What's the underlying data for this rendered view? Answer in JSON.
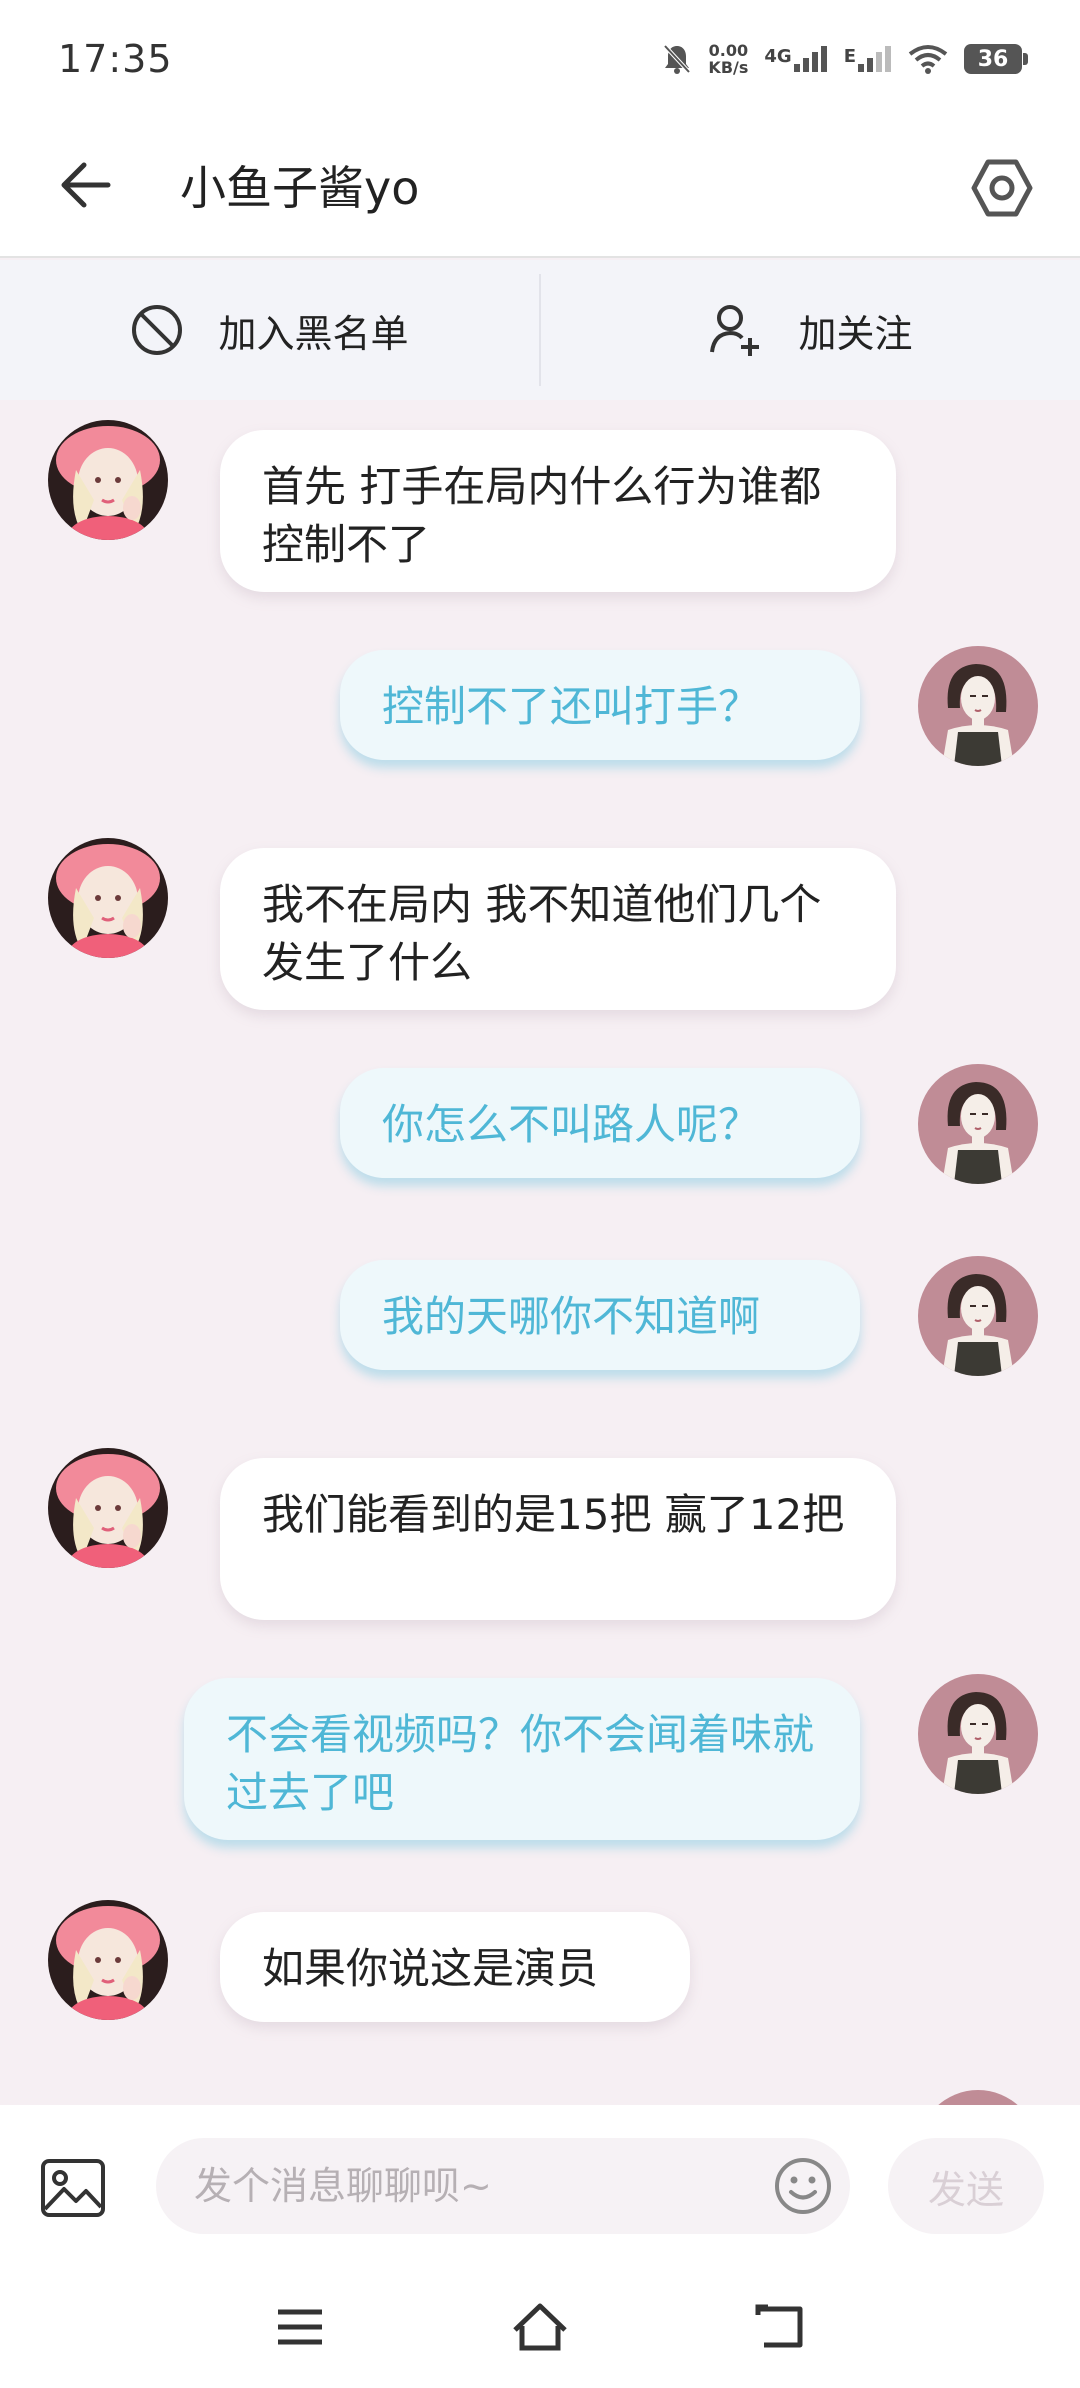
{
  "status_bar": {
    "time": "17:35",
    "net_speed_value": "0.00",
    "net_speed_unit": "KB/s",
    "signal1_label": "4G",
    "signal2_label": "E",
    "battery": "36",
    "icons": [
      "mute-bell-icon",
      "signal-icon",
      "signal-icon",
      "wifi-icon",
      "battery-icon"
    ]
  },
  "header": {
    "title": "小鱼子酱yo",
    "back_icon": "arrow-left-icon",
    "settings_icon": "hexagon-settings-icon"
  },
  "actions": {
    "blacklist_label": "加入黑名单",
    "follow_label": "加关注"
  },
  "messages": [
    {
      "side": "in",
      "text": "首先 打手在局内什么行为谁都控制不了"
    },
    {
      "side": "out",
      "text": "控制不了还叫打手？"
    },
    {
      "side": "in",
      "text": "我不在局内 我不知道他们几个发生了什么"
    },
    {
      "side": "out",
      "text": "你怎么不叫路人呢？"
    },
    {
      "side": "out",
      "text": "我的天哪你不知道啊"
    },
    {
      "side": "in",
      "text": "我们能看到的是15把 赢了12把"
    },
    {
      "side": "out",
      "text": "不会看视频吗？你不会闻着味就过去了吧"
    },
    {
      "side": "in",
      "text": "如果你说这是演员"
    }
  ],
  "input": {
    "placeholder": "发个消息聊聊呗~",
    "value": "",
    "send_label": "发送"
  },
  "colors": {
    "chat_background": "#f6eff3",
    "incoming_bubble": "#ffffff",
    "outgoing_bubble": "#eef8fb",
    "outgoing_text": "#4fb7d6"
  }
}
